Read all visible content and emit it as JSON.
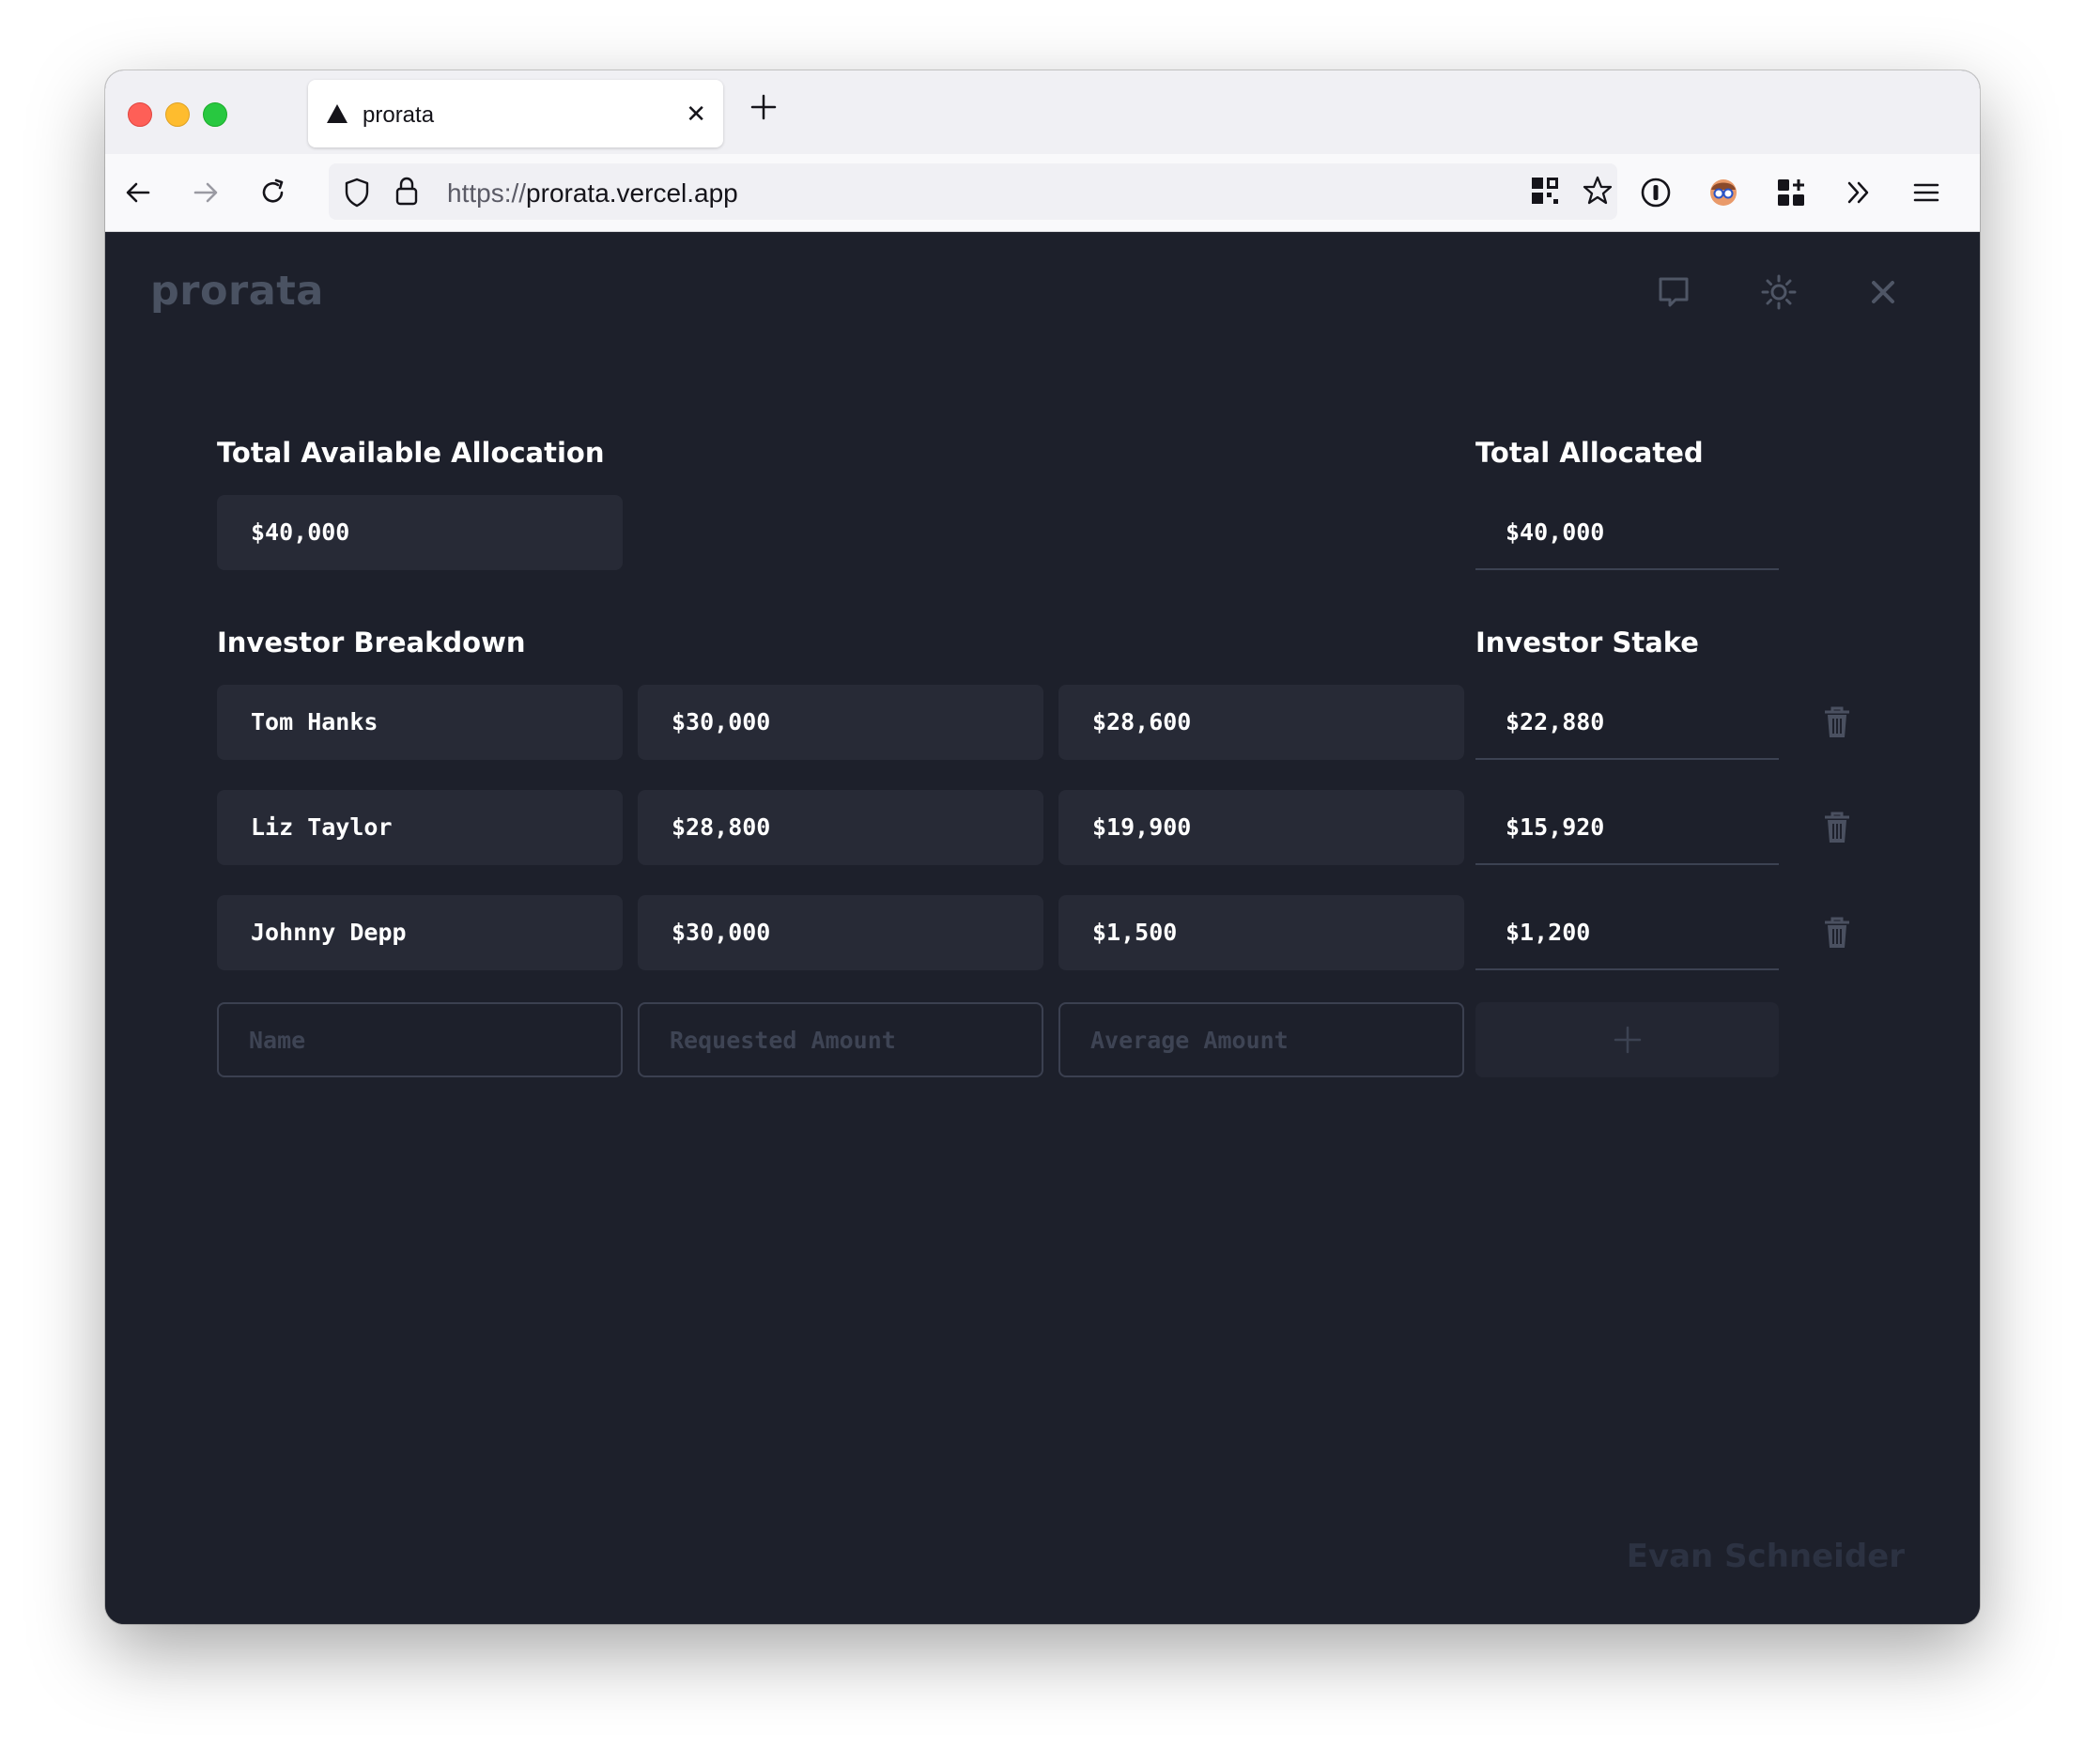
{
  "browser": {
    "tab_title": "prorata",
    "url_scheme": "https://",
    "url_host": "prorata.vercel.app"
  },
  "app": {
    "logo": "prorata",
    "header_icons": [
      "feedback-icon",
      "sun-icon",
      "close-icon"
    ]
  },
  "allocation": {
    "total_available_label": "Total Available Allocation",
    "total_available_value": "$40,000",
    "total_allocated_label": "Total Allocated",
    "total_allocated_value": "$40,000"
  },
  "breakdown": {
    "label": "Investor Breakdown",
    "stake_label": "Investor Stake",
    "rows": [
      {
        "name": "Tom Hanks",
        "requested": "$30,000",
        "average": "$28,600",
        "stake": "$22,880"
      },
      {
        "name": "Liz Taylor",
        "requested": "$28,800",
        "average": "$19,900",
        "stake": "$15,920"
      },
      {
        "name": "Johnny Depp",
        "requested": "$30,000",
        "average": "$1,500",
        "stake": "$1,200"
      }
    ]
  },
  "new_row": {
    "name_placeholder": "Name",
    "requested_placeholder": "Requested Amount",
    "average_placeholder": "Average Amount"
  },
  "footer": {
    "author": "Evan Schneider"
  }
}
